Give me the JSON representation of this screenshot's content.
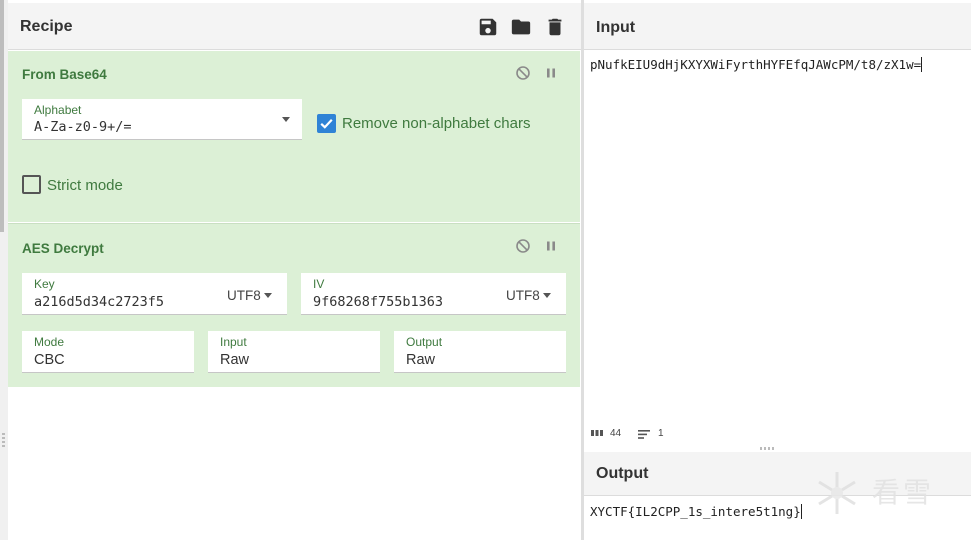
{
  "recipe": {
    "title": "Recipe",
    "icons": [
      "save-icon",
      "folder-icon",
      "trash-icon"
    ]
  },
  "operations": {
    "from_base64": {
      "title": "From Base64",
      "alphabet_label": "Alphabet",
      "alphabet_value": "A-Za-z0-9+/=",
      "remove_non_alphabet_label": "Remove non-alphabet chars",
      "remove_non_alphabet_checked": true,
      "strict_mode_label": "Strict mode",
      "strict_mode_checked": false
    },
    "aes_decrypt": {
      "title": "AES Decrypt",
      "key_label": "Key",
      "key_value": "a216d5d34c2723f5",
      "key_encoding": "UTF8",
      "iv_label": "IV",
      "iv_value": "9f68268f755b1363",
      "iv_encoding": "UTF8",
      "mode_label": "Mode",
      "mode_value": "CBC",
      "input_label": "Input",
      "input_value": "Raw",
      "output_label": "Output",
      "output_value": "Raw"
    }
  },
  "input": {
    "title": "Input",
    "text": "pNufkEIU9dHjKXYXWiFyrthHYFEfqJAWcPM/t8/zX1w=",
    "length": "44",
    "lines": "1"
  },
  "output": {
    "title": "Output",
    "text": "XYCTF{IL2CPP_1s_intere5t1ng}"
  },
  "colors": {
    "operation_bg": "#dcf0d6",
    "operation_text": "#3f7a3f",
    "checkbox_checked": "#2f83d6",
    "header_bg": "#f4f4f4"
  }
}
